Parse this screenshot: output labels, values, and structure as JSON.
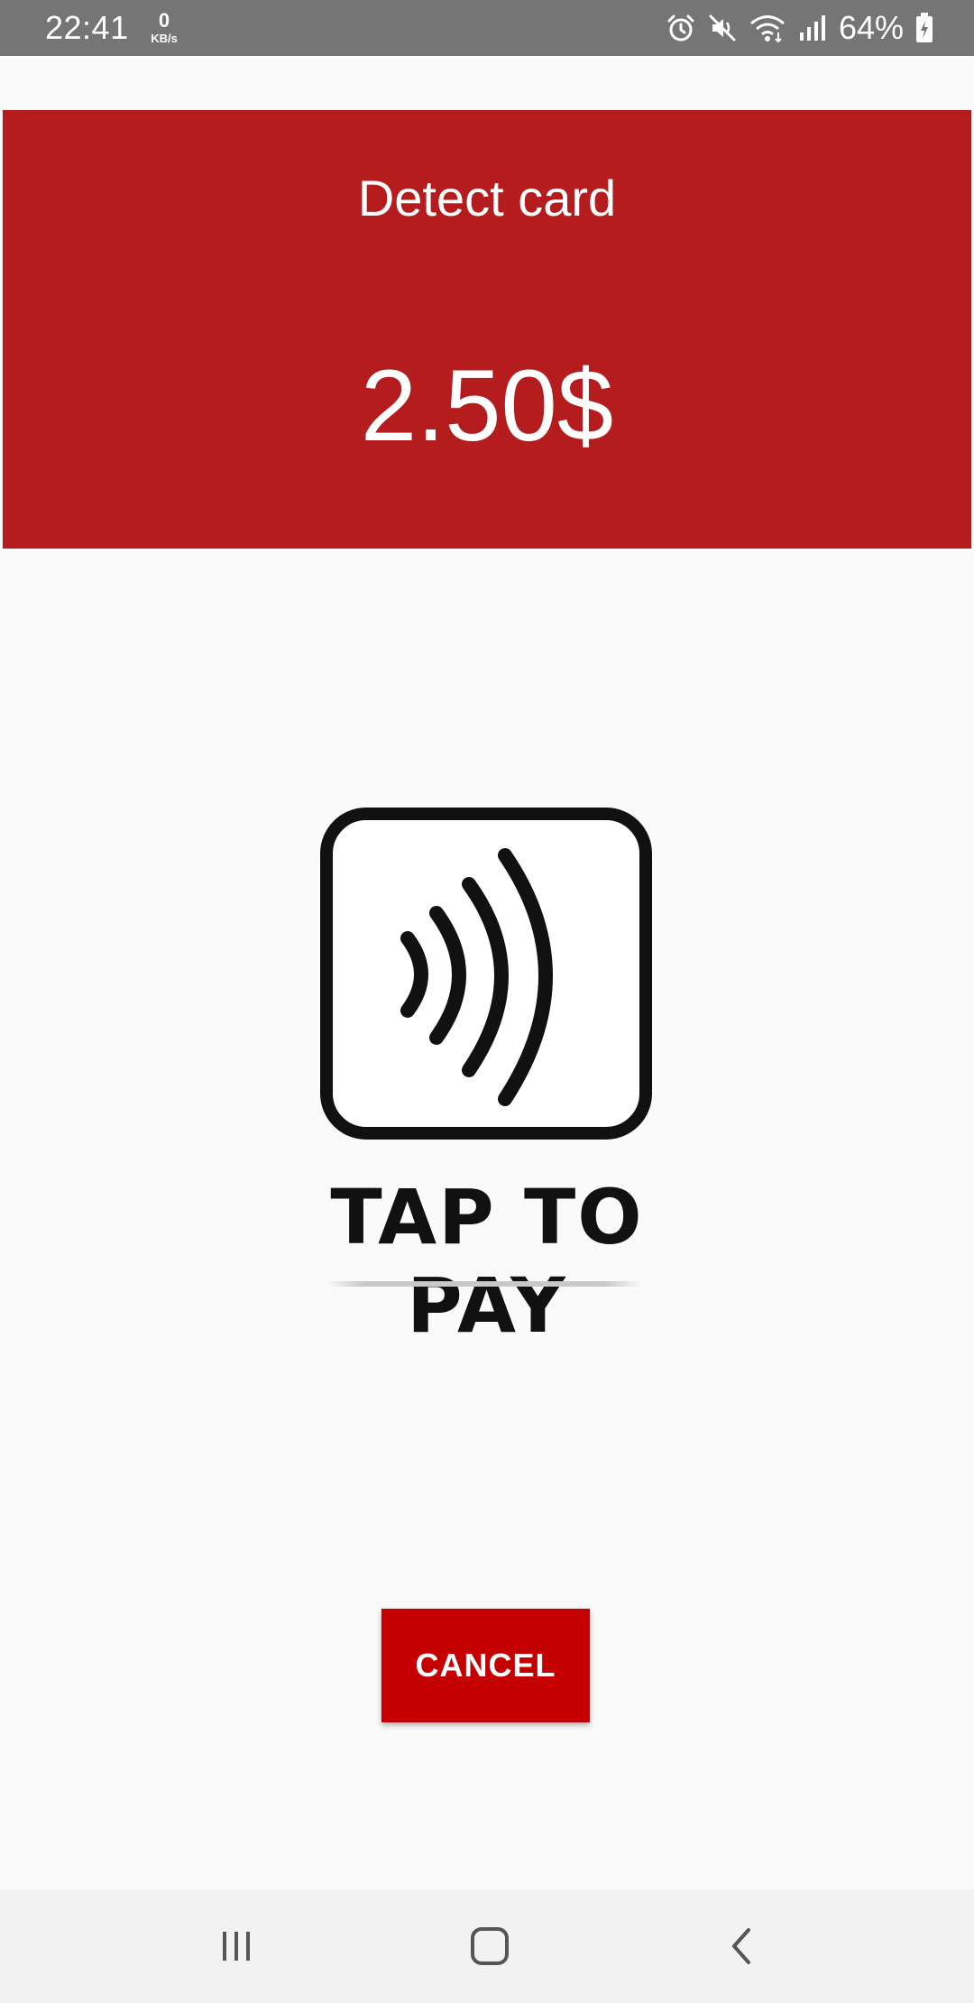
{
  "status_bar": {
    "time": "22:41",
    "speed_value": "0",
    "speed_unit": "KB/s",
    "battery_percent": "64%",
    "icons": [
      "alarm-icon",
      "mute-icon",
      "wifi-icon",
      "signal-icon",
      "battery-icon"
    ]
  },
  "header": {
    "title": "Detect card",
    "amount": "2.50$",
    "background_color": "#b51c1e"
  },
  "illustration": {
    "icon": "contactless-icon",
    "label": "TAP TO PAY"
  },
  "actions": {
    "cancel_label": "CANCEL",
    "button_color": "#c50000"
  },
  "nav_bar": {
    "icons": [
      "recent-apps-icon",
      "home-icon",
      "back-icon"
    ]
  }
}
